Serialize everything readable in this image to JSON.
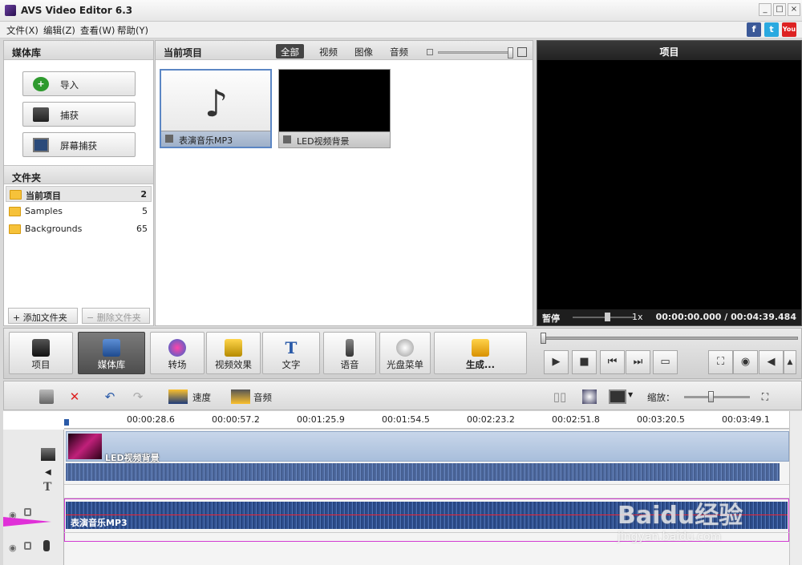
{
  "app": {
    "title": "AVS Video Editor 6.3"
  },
  "window": {
    "minimize": "_",
    "restore": "□",
    "close": "×"
  },
  "menu": [
    "文件(X)",
    "编辑(Z)",
    "查看(W)",
    "帮助(Y)"
  ],
  "social": {
    "facebook": "f",
    "twitter": "t",
    "youtube": "You"
  },
  "media_library": {
    "header": "媒体库",
    "buttons": {
      "import": "导入",
      "capture": "捕获",
      "screen_capture": "屏幕捕获"
    }
  },
  "folders": {
    "header": "文件夹",
    "items": [
      {
        "name": "当前项目",
        "count": "2"
      },
      {
        "name": "Samples",
        "count": "5"
      },
      {
        "name": "Backgrounds",
        "count": "65"
      }
    ],
    "add_label": "添加文件夹",
    "delete_label": "删除文件夹"
  },
  "project": {
    "header": "当前项目",
    "filters": [
      "全部",
      "视频",
      "图像",
      "音频"
    ],
    "active_filter": "全部",
    "items": [
      {
        "name": "表演音乐MP3",
        "kind": "audio"
      },
      {
        "name": "LED视频背景",
        "kind": "video"
      }
    ]
  },
  "preview": {
    "header": "项目",
    "state": "暂停",
    "speed": "1x",
    "time": "00:00:00.000 / 00:04:39.484"
  },
  "main_toolbar": [
    {
      "label": "项目",
      "icon": "clapper-icon"
    },
    {
      "label": "媒体库",
      "icon": "film-stack-icon",
      "active": true
    },
    {
      "label": "转场",
      "icon": "swirl-icon"
    },
    {
      "label": "视频效果",
      "icon": "effects-star-icon"
    },
    {
      "label": "文字",
      "icon": "text-t-icon"
    },
    {
      "label": "语音",
      "icon": "microphone-icon"
    },
    {
      "label": "光盘菜单",
      "icon": "disc-menu-icon"
    },
    {
      "label": "生成...",
      "icon": "produce-folder-icon"
    }
  ],
  "timeline_toolbar": {
    "speed_label": "速度",
    "audio_label": "音频",
    "zoom_label": "缩放："
  },
  "ruler": [
    "00:00:28.6",
    "00:00:57.2",
    "00:01:25.9",
    "00:01:54.5",
    "00:02:23.2",
    "00:02:51.8",
    "00:03:20.5",
    "00:03:49.1"
  ],
  "tracks": {
    "video_clip": "LED视频背景",
    "audio_clip": "表演音乐MP3"
  },
  "watermark": {
    "brand": "Baidu经验",
    "url": "jingyan.baidu.com"
  },
  "colors": {
    "accent": "#3b5998",
    "selection": "#d23bd2",
    "wave": "#2f4f8f"
  }
}
